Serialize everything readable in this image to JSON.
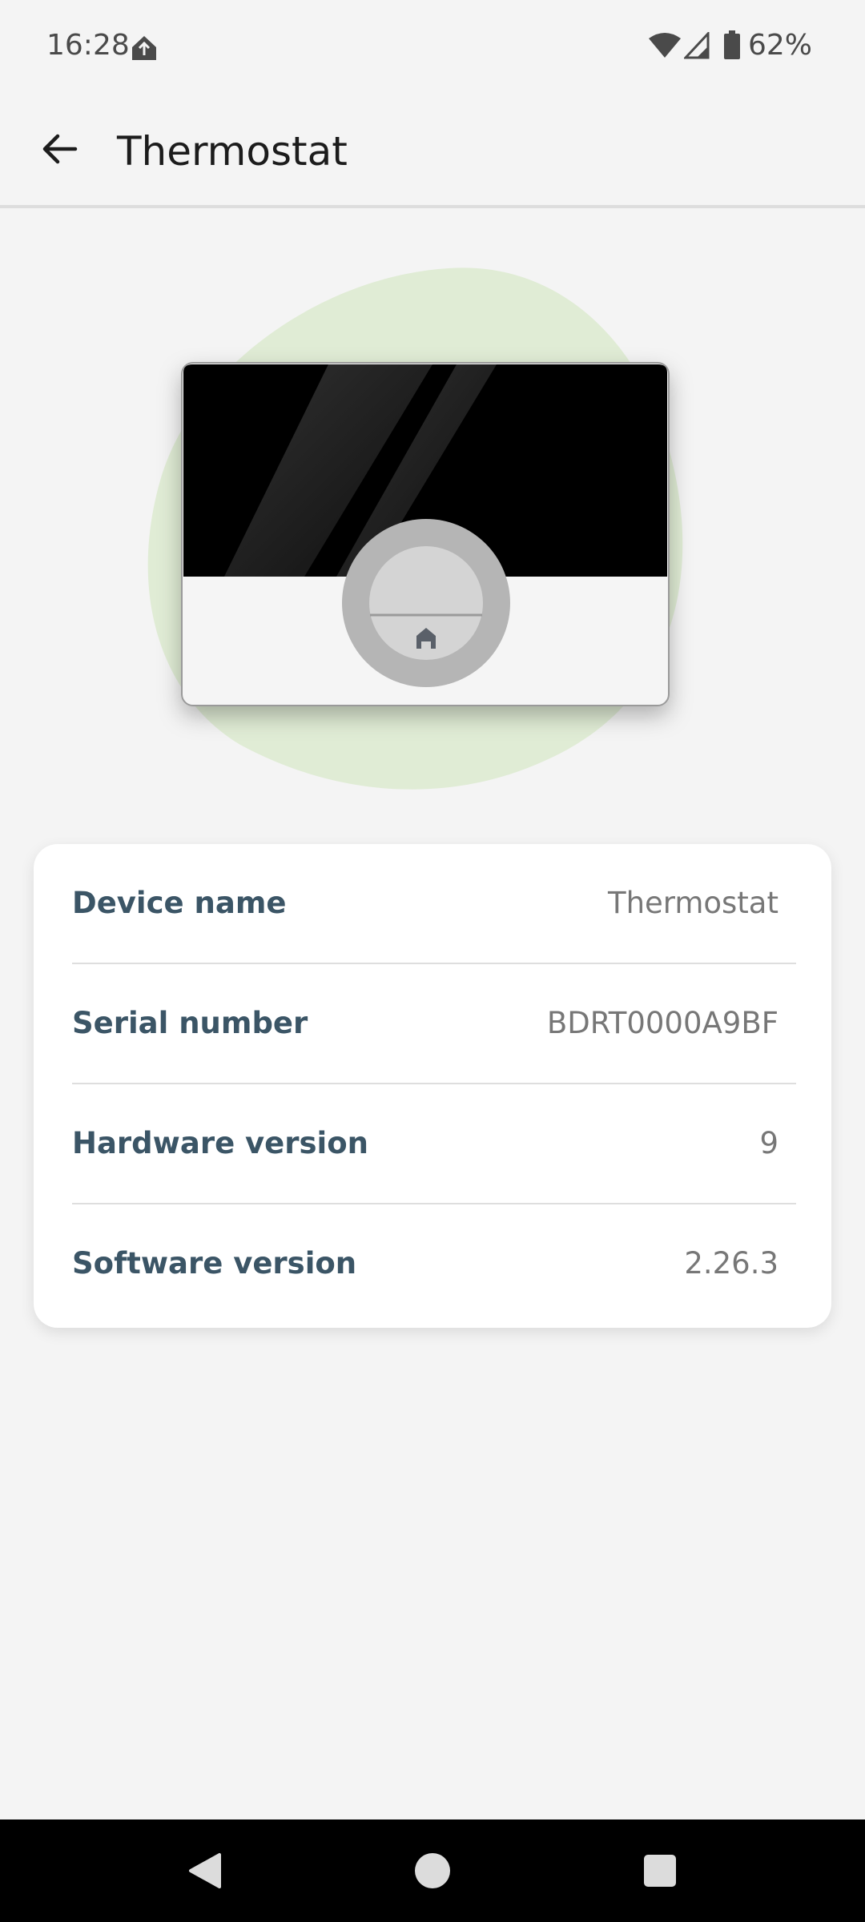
{
  "status_bar": {
    "time": "16:28",
    "battery": "62%",
    "icons": [
      "app-notification-icon",
      "wifi-icon",
      "cell-signal-icon",
      "battery-icon"
    ]
  },
  "app_bar": {
    "title": "Thermostat",
    "back_icon": "arrow-left-icon"
  },
  "illustration": {
    "subject": "thermostat-device",
    "blob_color": "#e0ecd5",
    "button_icon": "home-icon"
  },
  "device_info": {
    "rows": [
      {
        "label": "Device name",
        "value": "Thermostat"
      },
      {
        "label": "Serial number",
        "value": "BDRT0000A9BF"
      },
      {
        "label": "Hardware version",
        "value": "9"
      },
      {
        "label": "Software version",
        "value": "2.26.3"
      }
    ]
  },
  "nav_bar": {
    "buttons": [
      "back-triangle-icon",
      "home-circle-icon",
      "recents-square-icon"
    ]
  },
  "colors": {
    "background": "#f4f4f4",
    "label": "#3b5566",
    "value": "#777777",
    "card": "#ffffff"
  }
}
